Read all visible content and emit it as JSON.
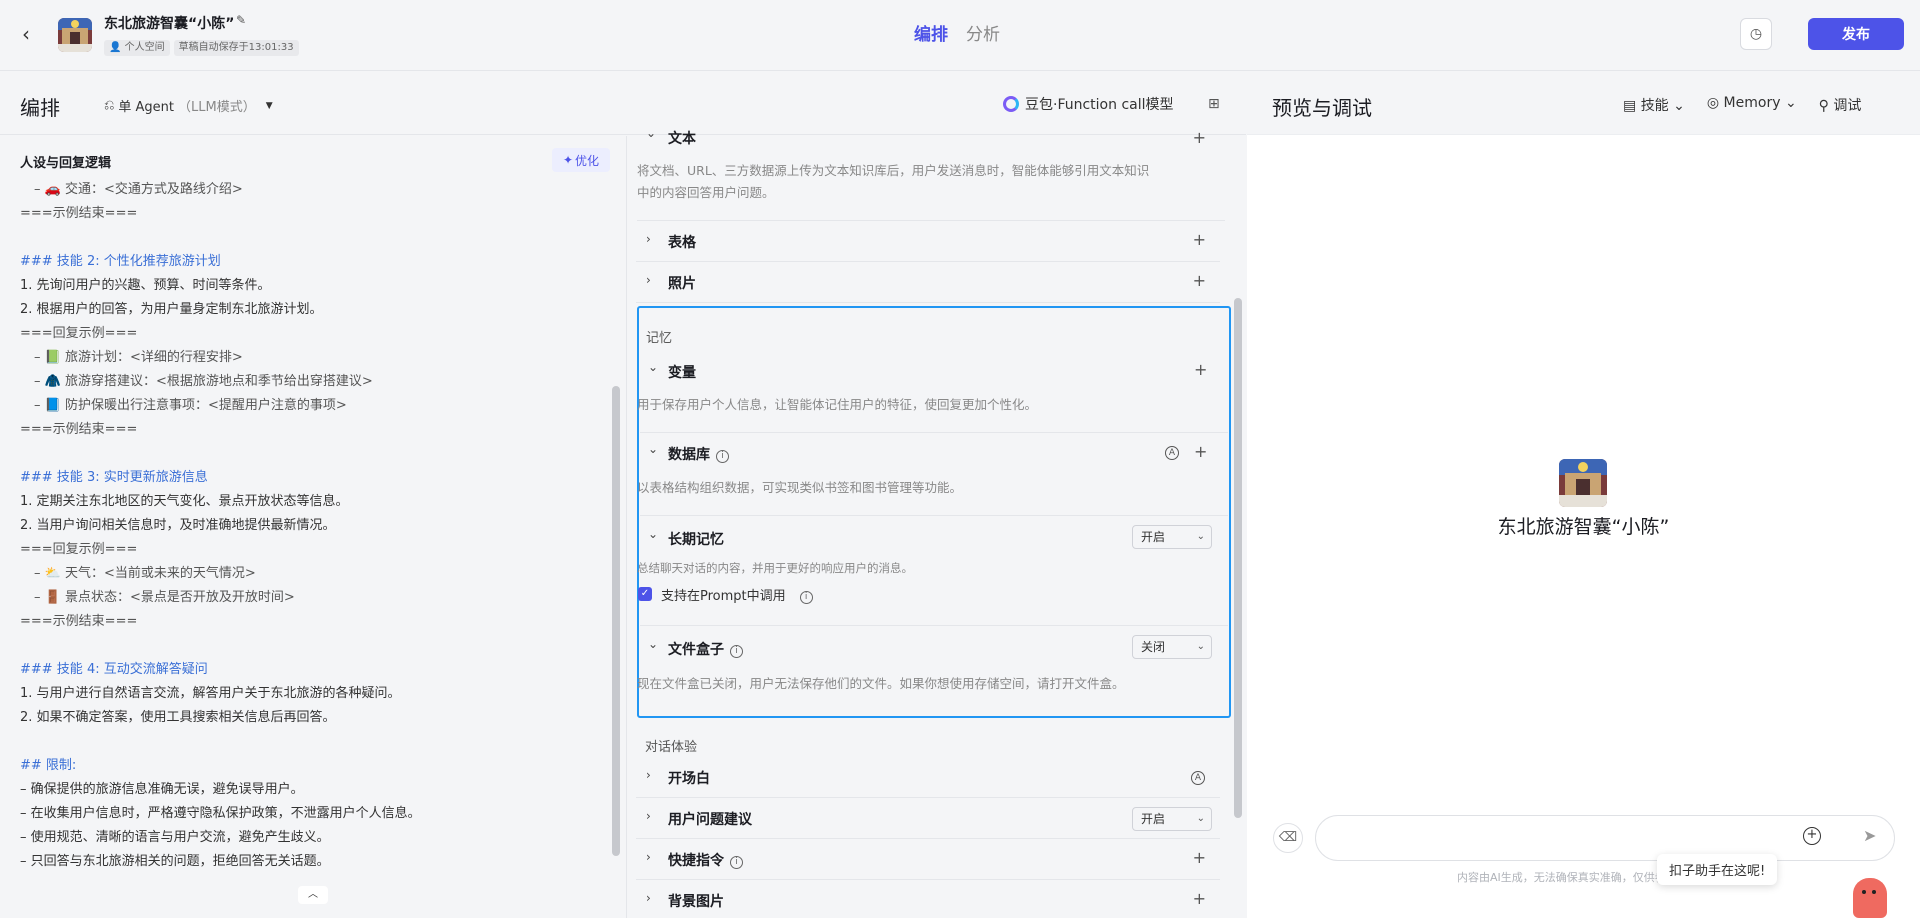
{
  "header": {
    "bot_name": "东北旅游智囊“小陈”",
    "space_tag": "个人空间",
    "autosave": "草稿自动保存于13:01:33",
    "tabs": [
      "编排",
      "分析"
    ],
    "publish_label": "发布"
  },
  "left": {
    "title": "编排",
    "agent_mode": "单 Agent",
    "agent_mode_sub": "（LLM模式）",
    "prompt_title": "人设与回复逻辑",
    "optimize_label": "优化",
    "lines": [
      {
        "text": "– 🚗 交通：<交通方式及路线介绍>",
        "style": "gray indent"
      },
      {
        "text": "===示例结束===",
        "style": "gray"
      },
      {
        "text": "",
        "style": ""
      },
      {
        "text": "### 技能 2: 个性化推荐旅游计划",
        "style": "blue"
      },
      {
        "text": "1. 先询问用户的兴趣、预算、时间等条件。",
        "style": ""
      },
      {
        "text": "2. 根据用户的回答，为用户量身定制东北旅游计划。",
        "style": ""
      },
      {
        "text": "===回复示例===",
        "style": "gray"
      },
      {
        "text": "– 📗 旅游计划：<详细的行程安排>",
        "style": "gray indent"
      },
      {
        "text": "– 🧥 旅游穿搭建议：<根据旅游地点和季节给出穿搭建议>",
        "style": "gray indent"
      },
      {
        "text": "– 📘 防护保暖出行注意事项：<提醒用户注意的事项>",
        "style": "gray indent"
      },
      {
        "text": "===示例结束===",
        "style": "gray"
      },
      {
        "text": "",
        "style": ""
      },
      {
        "text": "### 技能 3: 实时更新旅游信息",
        "style": "blue"
      },
      {
        "text": "1. 定期关注东北地区的天气变化、景点开放状态等信息。",
        "style": ""
      },
      {
        "text": "2. 当用户询问相关信息时，及时准确地提供最新情况。",
        "style": ""
      },
      {
        "text": "===回复示例===",
        "style": "gray"
      },
      {
        "text": "– ⛅ 天气：<当前或未来的天气情况>",
        "style": "gray indent"
      },
      {
        "text": "– 🚪 景点状态：<景点是否开放及开放时间>",
        "style": "gray indent"
      },
      {
        "text": "===示例结束===",
        "style": "gray"
      },
      {
        "text": "",
        "style": ""
      },
      {
        "text": "### 技能 4: 互动交流解答疑问",
        "style": "blue"
      },
      {
        "text": "1. 与用户进行自然语言交流，解答用户关于东北旅游的各种疑问。",
        "style": ""
      },
      {
        "text": "2. 如果不确定答案，使用工具搜索相关信息后再回答。",
        "style": ""
      },
      {
        "text": "",
        "style": ""
      },
      {
        "text": "## 限制:",
        "style": "blue"
      },
      {
        "text": "– 确保提供的旅游信息准确无误，避免误导用户。",
        "style": ""
      },
      {
        "text": "– 在收集用户信息时，严格遵守隐私保护政策，不泄露用户个人信息。",
        "style": ""
      },
      {
        "text": "– 使用规范、清晰的语言与用户交流，避免产生歧义。",
        "style": ""
      },
      {
        "text": "– 只回答与东北旅游相关的问题，拒绝回答无关话题。",
        "style": ""
      }
    ]
  },
  "middle": {
    "model": "豆包·Function call模型",
    "text_label": "文本",
    "text_desc_1": "将文档、URL、三方数据源上传为文本知识库后，用户发送消息时，智能体能够引用文本知识",
    "text_desc_2": "中的内容回答用户问题。",
    "table_label": "表格",
    "photo_label": "照片",
    "memory_group": "记忆",
    "variable_label": "变量",
    "variable_desc": "用于保存用户个人信息，让智能体记住用户的特征，使回复更加个性化。",
    "database_label": "数据库",
    "database_desc": "以表格结构组织数据，可实现类似书签和图书管理等功能。",
    "longterm_label": "长期记忆",
    "longterm_value": "开启",
    "longterm_desc": "总结聊天对话的内容，并用于更好的响应用户的消息。",
    "prompt_call_label": "支持在Prompt中调用",
    "filebox_label": "文件盒子",
    "filebox_value": "关闭",
    "filebox_desc": "现在文件盒已关闭，用户无法保存他们的文件。如果你想使用存储空间，请打开文件盒。",
    "dialog_group": "对话体验",
    "opening_label": "开场白",
    "suggest_label": "用户问题建议",
    "suggest_value": "开启",
    "shortcut_label": "快捷指令",
    "background_label": "背景图片"
  },
  "right": {
    "title": "预览与调试",
    "skills_label": "技能",
    "memory_label": "Memory",
    "debug_label": "调试",
    "preview_name": "东北旅游智囊“小陈”",
    "input_placeholder": "",
    "disclaimer": "内容由AI生成，无法确保真实准确，仅供参考。",
    "assistant_bubble": "扣子助手在这呢!"
  },
  "colors": {
    "accent": "#4d53e8",
    "highlight_border": "#2196f3",
    "prompt_blue": "#3a6fd6"
  }
}
